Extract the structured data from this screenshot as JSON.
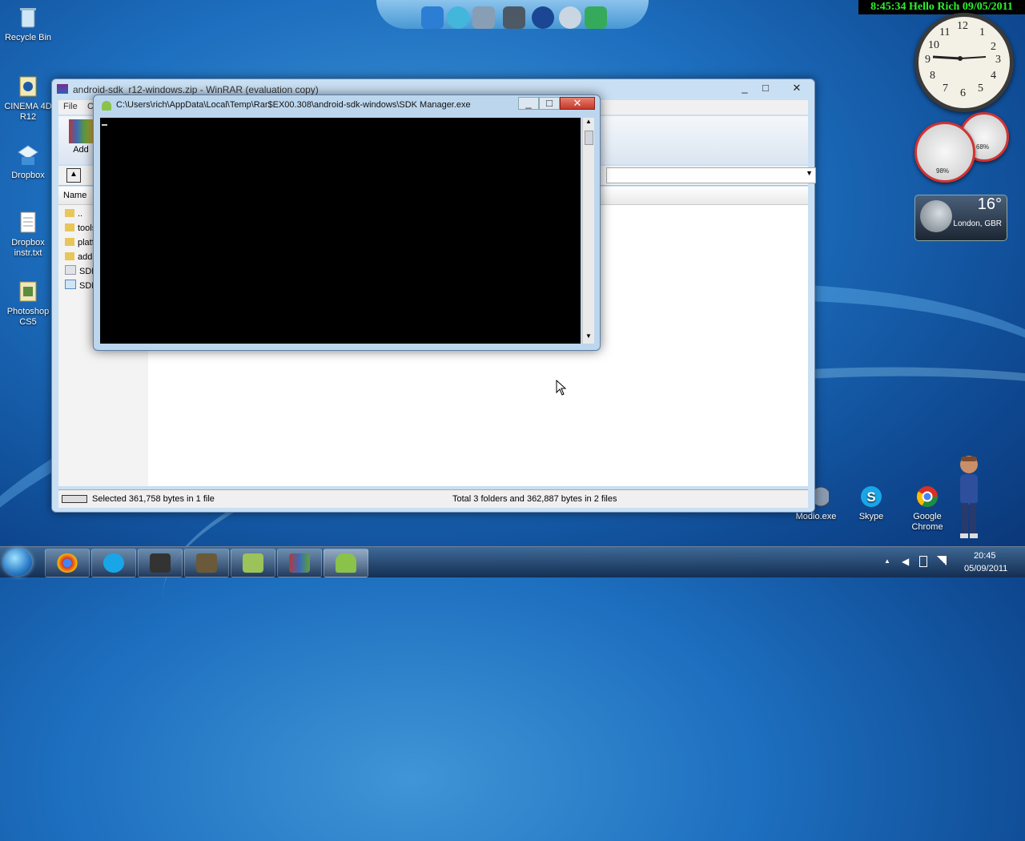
{
  "desktop": {
    "icons": [
      {
        "label": "Recycle Bin"
      },
      {
        "label": "CINEMA 4D R12"
      },
      {
        "label": "Dropbox"
      },
      {
        "label": "Dropbox instr.txt"
      },
      {
        "label": "Photoshop CS5"
      }
    ],
    "right_icons": [
      {
        "label": "Modio.exe"
      },
      {
        "label": "Skype"
      },
      {
        "label": "Google Chrome"
      }
    ]
  },
  "gadgets": {
    "banner": "8:45:34 Hello Rich 09/05/2011",
    "clock_numbers": [
      "12",
      "1",
      "2",
      "3",
      "4",
      "5",
      "6",
      "7",
      "8",
      "9",
      "10",
      "11"
    ],
    "cpu_pct": "98%",
    "mem_pct": "68%",
    "weather_temp": "16°",
    "weather_city": "London, GBR"
  },
  "winrar": {
    "title": "android-sdk_r12-windows.zip - WinRAR (evaluation copy)",
    "menu": [
      "File",
      "C"
    ],
    "toolbar_add": "Add",
    "column_name": "Name",
    "rows": [
      "..",
      "tools",
      "platf",
      "add-",
      "SDK",
      "SDK"
    ],
    "status_left": "Selected 361,758 bytes in 1 file",
    "status_right": "Total 3 folders and 362,887 bytes in 2 files"
  },
  "console": {
    "title": "C:\\Users\\rich\\AppData\\Local\\Temp\\Rar$EX00.308\\android-sdk-windows\\SDK Manager.exe"
  },
  "taskbar": {
    "time": "20:45",
    "date": "05/09/2011"
  },
  "colors": {
    "banner_text": "#2df02d",
    "console_bg": "#000000"
  }
}
